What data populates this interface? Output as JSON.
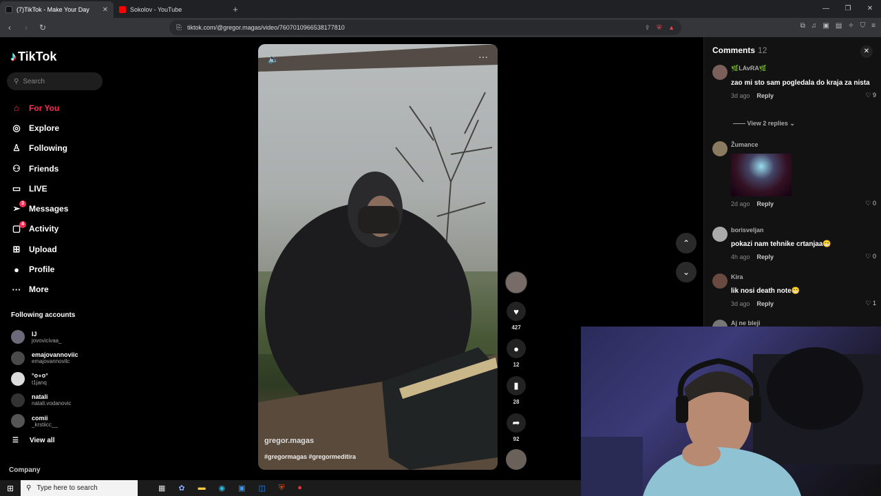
{
  "browser": {
    "tabs": [
      {
        "title": "(7)TikTok - Make Your Day",
        "active": true,
        "favicon_color": "#111111"
      },
      {
        "title": "Sokolov - YouTube",
        "active": false,
        "favicon_color": "#ff0000"
      }
    ],
    "url": "tiktok.com/@gregor.magas/video/7607010966538177810"
  },
  "sidebar": {
    "logo": "TikTok",
    "search_placeholder": "Search",
    "nav": [
      {
        "label": "For You",
        "icon": "home-icon",
        "active": true
      },
      {
        "label": "Explore",
        "icon": "compass-icon"
      },
      {
        "label": "Following",
        "icon": "user-follow-icon"
      },
      {
        "label": "Friends",
        "icon": "friends-icon"
      },
      {
        "label": "LIVE",
        "icon": "live-tv-icon"
      },
      {
        "label": "Messages",
        "icon": "paper-plane-icon",
        "badge": "3"
      },
      {
        "label": "Activity",
        "icon": "inbox-icon",
        "badge": "4"
      },
      {
        "label": "Upload",
        "icon": "plus-square-icon"
      },
      {
        "label": "Profile",
        "icon": "avatar-icon"
      },
      {
        "label": "More",
        "icon": "more-dots-icon"
      }
    ],
    "following_title": "Following accounts",
    "following": [
      {
        "name": "IJ",
        "handle": "jovovicivaa_"
      },
      {
        "name": "emajovannoviic",
        "handle": "emajovannovilc"
      },
      {
        "name": "°o∘o°",
        "handle": "t1janq"
      },
      {
        "name": "natali",
        "handle": "natali.vodanovic"
      },
      {
        "name": "comii",
        "handle": "_krstiicc__"
      }
    ],
    "view_all": "View all",
    "company": "Company"
  },
  "video": {
    "author": "gregor.magas",
    "tags": "#gregormagas #gregormeditira",
    "likes": "427",
    "comments": "12",
    "saves": "28",
    "shares": "92"
  },
  "comments": {
    "title": "Comments",
    "count": "12",
    "items": [
      {
        "user": "🌿LAvRA🌿",
        "text": "zao mi sto sam pogledala do kraja za nista",
        "time": "3d ago",
        "reply": "Reply",
        "likes": "9"
      },
      {
        "user": "Žumance",
        "text": "",
        "time": "2d ago",
        "reply": "Reply",
        "likes": "0",
        "has_image": true
      },
      {
        "user": "borisveljan",
        "text": "pokazi nam tehnike crtanjaa😁",
        "time": "4h ago",
        "reply": "Reply",
        "likes": "0"
      },
      {
        "user": "Kira",
        "text": "lik nosi death note😁",
        "time": "3d ago",
        "reply": "Reply",
        "likes": "1"
      },
      {
        "user": "Aj ne bleji",
        "text": "",
        "time": "",
        "reply": "",
        "likes": ""
      }
    ],
    "view_replies": "View 2 replies"
  },
  "taskbar": {
    "search_placeholder": "Type here to search"
  }
}
